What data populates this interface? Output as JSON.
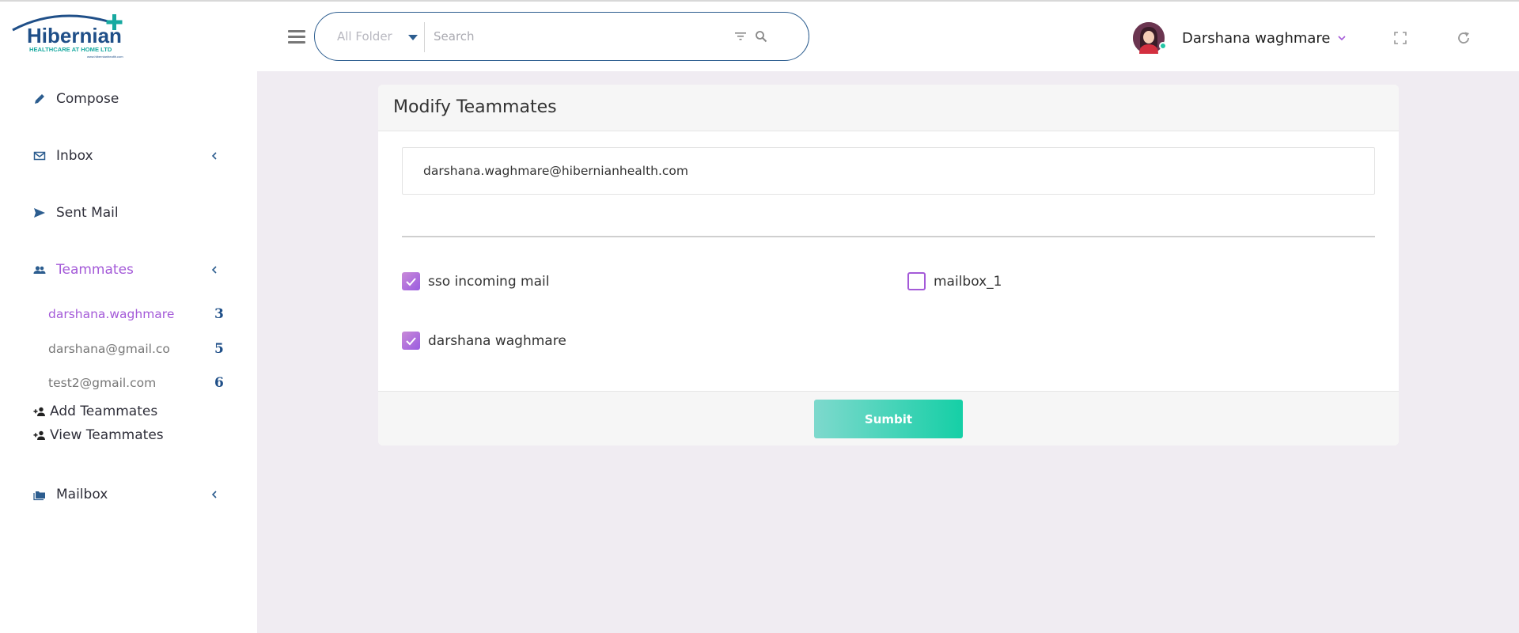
{
  "brand": {
    "name": "Hibernian",
    "tagline": "HEALTHCARE AT HOME LTD",
    "url": "www.hibernianhealth.com",
    "colors": {
      "primary": "#1f4f88",
      "accent": "#a45ad8",
      "teal": "#15cfa6"
    }
  },
  "header": {
    "folder_select": "All Folder",
    "search_placeholder": "Search",
    "user_name": "Darshana waghmare"
  },
  "sidebar": {
    "compose": "Compose",
    "inbox": "Inbox",
    "sent": "Sent Mail",
    "teammates": "Teammates",
    "teammate_items": [
      {
        "label": "darshana.waghmare",
        "count": "3"
      },
      {
        "label": "darshana@gmail.co",
        "count": "5"
      },
      {
        "label": "test2@gmail.com",
        "count": "6"
      }
    ],
    "add_teammates": "Add Teammates",
    "view_teammates": "View Teammates",
    "mailbox": "Mailbox"
  },
  "form": {
    "title": "Modify Teammates",
    "email": "darshana.waghmare@hibernianhealth.com",
    "checkboxes": [
      {
        "label": "sso incoming mail",
        "checked": true
      },
      {
        "label": "mailbox_1",
        "checked": false
      },
      {
        "label": "darshana waghmare",
        "checked": true
      }
    ],
    "submit_label": "Sumbit"
  }
}
